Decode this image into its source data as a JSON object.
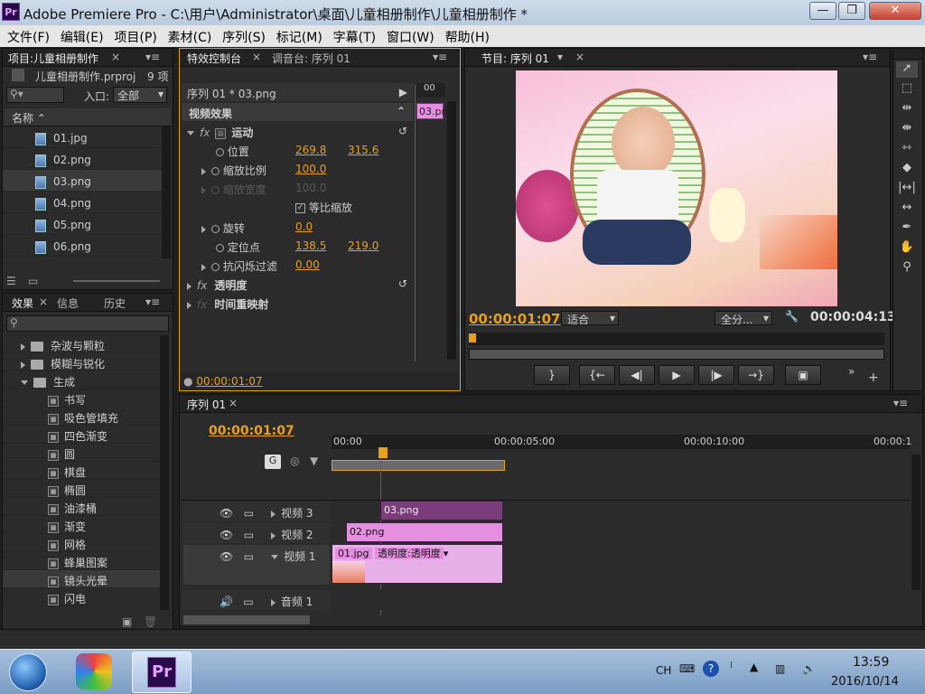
{
  "window": {
    "app_badge": "Pr",
    "title": "Adobe Premiere Pro - C:\\用户\\Administrator\\桌面\\儿童相册制作\\儿童相册制作 *",
    "minimize": "—",
    "maximize": "❐",
    "close": "✕"
  },
  "menu": [
    "文件(F)",
    "编辑(E)",
    "项目(P)",
    "素材(C)",
    "序列(S)",
    "标记(M)",
    "字幕(T)",
    "窗口(W)",
    "帮助(H)"
  ],
  "project": {
    "tab": "项目:儿童相册制作",
    "file": "儿童相册制作.prproj",
    "count": "9 项",
    "in_label": "入口:",
    "in_value": "全部",
    "column": "名称",
    "items": [
      "01.jpg",
      "02.png",
      "03.png",
      "04.png",
      "05.png",
      "06.png"
    ]
  },
  "effects": {
    "tabs": [
      "效果",
      "信息",
      "历史"
    ],
    "search_placeholder": "",
    "folders": [
      "杂波与颗粒",
      "模糊与锐化",
      "生成"
    ],
    "items": [
      "书写",
      "吸色管填充",
      "四色渐变",
      "圆",
      "棋盘",
      "椭圆",
      "油漆桶",
      "渐变",
      "网格",
      "蜂巢图案",
      "镜头光晕",
      "闪电"
    ]
  },
  "effect_controls": {
    "tab_active": "特效控制台",
    "tab_mixer": "调音台: 序列 01",
    "clip_header": "序列 01 * 03.png",
    "ruler_mark": "00",
    "clip_label": "03.png",
    "video_effects": "视频效果",
    "motion": "运动",
    "position_label": "位置",
    "position_x": "269.8",
    "position_y": "315.6",
    "scale_label": "缩放比例",
    "scale_value": "100.0",
    "scale_width_label": "缩放宽度",
    "scale_width_value": "100.0",
    "uniform_scale": "等比缩放",
    "rotation_label": "旋转",
    "rotation_value": "0.0",
    "anchor_label": "定位点",
    "anchor_x": "138.5",
    "anchor_y": "219.0",
    "flicker_label": "抗闪烁过滤",
    "flicker_value": "0.00",
    "opacity": "透明度",
    "time_remap": "时间重映射",
    "timecode": "00:00:01:07"
  },
  "program": {
    "tab": "节目: 序列 01",
    "timecode": "00:00:01:07",
    "fit": "适合",
    "resolution": "全分...",
    "duration": "00:00:04:13"
  },
  "timeline": {
    "tab": "序列 01",
    "timecode": "00:00:01:07",
    "ruler": [
      "00:00",
      "00:00:05:00",
      "00:00:10:00",
      "00:00:1"
    ],
    "tracks": [
      {
        "name": "视频 3",
        "clip": "03.png"
      },
      {
        "name": "视频 2",
        "clip": "02.png"
      },
      {
        "name": "视频 1",
        "clip": "01.jpg",
        "clip_extra": "透明度:透明度"
      },
      {
        "name": "音频 1",
        "clip": ""
      }
    ]
  },
  "taskbar": {
    "lang": "CH",
    "time": "13:59",
    "date": "2016/10/14",
    "pr_badge": "Pr"
  },
  "colors": {
    "accent_orange": "#e8a020",
    "clip_pink": "#e68fe0",
    "clip_purple": "#7a3d7a",
    "playhead": "#d03020"
  }
}
